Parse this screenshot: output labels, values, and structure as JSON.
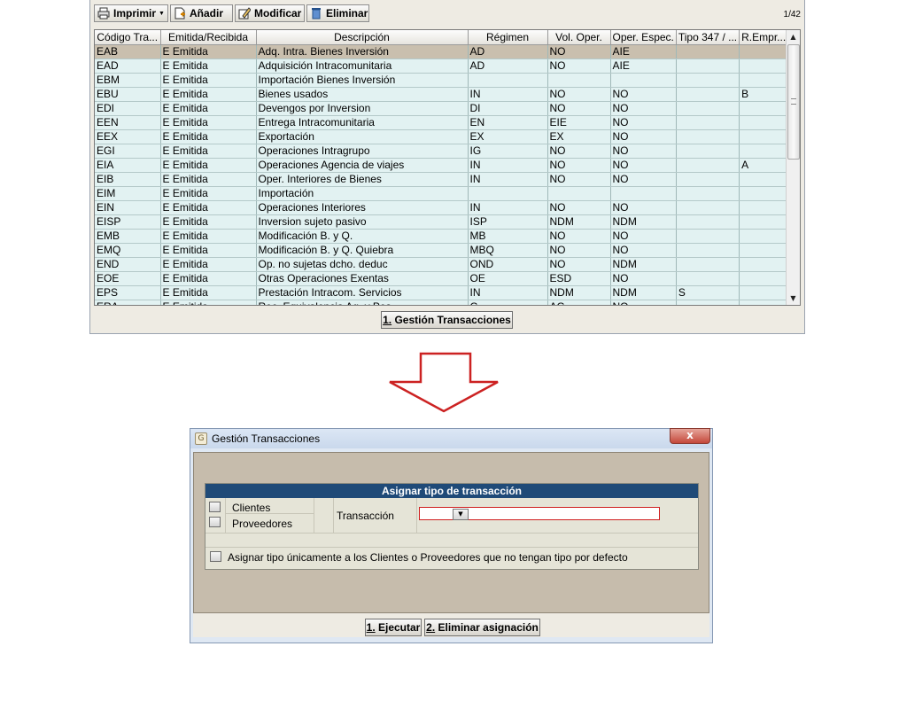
{
  "toolbar": {
    "print": "Imprimir",
    "add": "Añadir",
    "modify": "Modificar",
    "delete": "Eliminar",
    "page_count": "1/42"
  },
  "grid": {
    "columns": [
      "Código Tra...",
      "Emitida/Recibida",
      "Descripción",
      "Régimen",
      "Vol. Oper.",
      "Oper. Espec.",
      "Tipo 347 / ...",
      "R.Empr..."
    ],
    "rows": [
      [
        "EAB",
        "E  Emitida",
        "Adq. Intra. Bienes Inversión",
        "AD",
        "NO",
        "AIE",
        "",
        ""
      ],
      [
        "EAD",
        "E  Emitida",
        "Adquisición Intracomunitaria",
        "AD",
        "NO",
        "AIE",
        "",
        ""
      ],
      [
        "EBM",
        "E  Emitida",
        "Importación Bienes Inversión",
        "",
        "",
        "",
        "",
        ""
      ],
      [
        "EBU",
        "E  Emitida",
        "Bienes usados",
        "IN",
        "NO",
        "NO",
        "",
        "B"
      ],
      [
        "EDI",
        "E  Emitida",
        "Devengos por Inversion",
        "DI",
        "NO",
        "NO",
        "",
        ""
      ],
      [
        "EEN",
        "E  Emitida",
        "Entrega Intracomunitaria",
        "EN",
        "EIE",
        "NO",
        "",
        ""
      ],
      [
        "EEX",
        "E  Emitida",
        "Exportación",
        "EX",
        "EX",
        "NO",
        "",
        ""
      ],
      [
        "EGI",
        "E  Emitida",
        "Operaciones Intragrupo",
        "IG",
        "NO",
        "NO",
        "",
        ""
      ],
      [
        "EIA",
        "E  Emitida",
        "Operaciones Agencia de viajes",
        "IN",
        "NO",
        "NO",
        "",
        "A"
      ],
      [
        "EIB",
        "E  Emitida",
        "Oper. Interiores de Bienes",
        "IN",
        "NO",
        "NO",
        "",
        ""
      ],
      [
        "EIM",
        "E  Emitida",
        "Importación",
        "",
        "",
        "",
        "",
        ""
      ],
      [
        "EIN",
        "E  Emitida",
        "Operaciones Interiores",
        "IN",
        "NO",
        "NO",
        "",
        ""
      ],
      [
        "EISP",
        "E  Emitida",
        "Inversion sujeto pasivo",
        "ISP",
        "NDM",
        "NDM",
        "",
        ""
      ],
      [
        "EMB",
        "E  Emitida",
        "Modificación B. y Q.",
        "MB",
        "NO",
        "NO",
        "",
        ""
      ],
      [
        "EMQ",
        "E  Emitida",
        "Modificación B. y Q. Quiebra",
        "MBQ",
        "NO",
        "NO",
        "",
        ""
      ],
      [
        "END",
        "E  Emitida",
        "Op. no sujetas dcho. deduc",
        "OND",
        "NO",
        "NDM",
        "",
        ""
      ],
      [
        "EOE",
        "E  Emitida",
        "Otras Operaciones Exentas",
        "OE",
        "ESD",
        "NO",
        "",
        ""
      ],
      [
        "EPS",
        "E  Emitida",
        "Prestación Intracom. Servicios",
        "IN",
        "NDM",
        "NDM",
        "S",
        ""
      ],
      [
        "ERA",
        "E  Emitida",
        "Rec. Equivalencia Ag. y Pes.",
        "G",
        "AG",
        "NO",
        "",
        ""
      ]
    ]
  },
  "top_button": {
    "hotkey": "1.",
    "label": " Gestión Transacciones"
  },
  "dialog": {
    "title": "Gestión Transacciones",
    "close": "x",
    "section_header": "Asignar tipo de transacción",
    "clients": "Clientes",
    "suppliers": "Proveedores",
    "transaction_label": "Transacción",
    "transaction_value": "",
    "assign_default_only": "Asignar tipo únicamente a los Clientes o Proveedores que no tengan tipo por defecto",
    "execute_hotkey": "1.",
    "execute_label": " Ejecutar",
    "remove_hotkey": "2.",
    "remove_label": " Eliminar asignación"
  },
  "colors": {
    "selected_row": "#c9bfae",
    "grid_bg": "#e2f2f2",
    "header_blue": "#1f4a78",
    "arrow_red": "#cc2222"
  }
}
